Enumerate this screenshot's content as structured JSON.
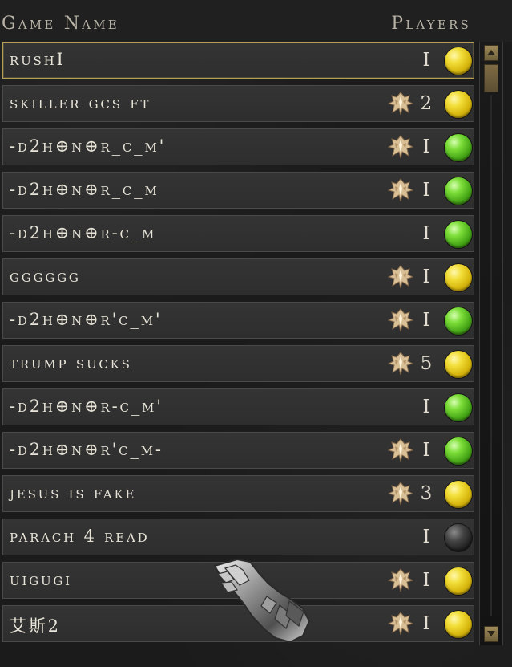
{
  "header": {
    "game_name_label": "Game Name",
    "players_label": "Players"
  },
  "games": [
    {
      "name": "rushI",
      "players": "I",
      "hardcore": false,
      "status": "yellow",
      "selected": true
    },
    {
      "name": "skiller gcs ft",
      "players": "2",
      "hardcore": true,
      "status": "yellow",
      "selected": false
    },
    {
      "name": "-d2h⊕n⊕r_c_m'",
      "players": "I",
      "hardcore": true,
      "status": "green",
      "selected": false
    },
    {
      "name": "-d2h⊕n⊕r_c_m",
      "players": "I",
      "hardcore": true,
      "status": "green",
      "selected": false
    },
    {
      "name": "-d2h⊕n⊕r-c_m",
      "players": "I",
      "hardcore": false,
      "status": "green",
      "selected": false
    },
    {
      "name": "gggggg",
      "players": "I",
      "hardcore": true,
      "status": "yellow",
      "selected": false
    },
    {
      "name": "-d2h⊕n⊕r'c_m'",
      "players": "I",
      "hardcore": true,
      "status": "green",
      "selected": false
    },
    {
      "name": "trump sucks",
      "players": "5",
      "hardcore": true,
      "status": "yellow",
      "selected": false
    },
    {
      "name": "-d2h⊕n⊕r-c_m'",
      "players": "I",
      "hardcore": false,
      "status": "green",
      "selected": false
    },
    {
      "name": "-d2h⊕n⊕r'c_m-",
      "players": "I",
      "hardcore": true,
      "status": "green",
      "selected": false
    },
    {
      "name": "jesus is fake",
      "players": "3",
      "hardcore": true,
      "status": "yellow",
      "selected": false
    },
    {
      "name": "parach 4 read",
      "players": "I",
      "hardcore": false,
      "status": "dark",
      "selected": false
    },
    {
      "name": "uigugi",
      "players": "I",
      "hardcore": true,
      "status": "yellow",
      "selected": false
    },
    {
      "name": "艾斯2",
      "players": "I",
      "hardcore": true,
      "status": "yellow",
      "selected": false
    }
  ],
  "icons": {
    "hardcore": "hardcore-icon",
    "status": "status-light-icon",
    "cursor": "gauntlet-cursor-icon"
  },
  "colors": {
    "yellow": "#e2c51d",
    "green": "#52b61f",
    "dark": "#2b2b2b",
    "gold_border": "#b79f57"
  }
}
